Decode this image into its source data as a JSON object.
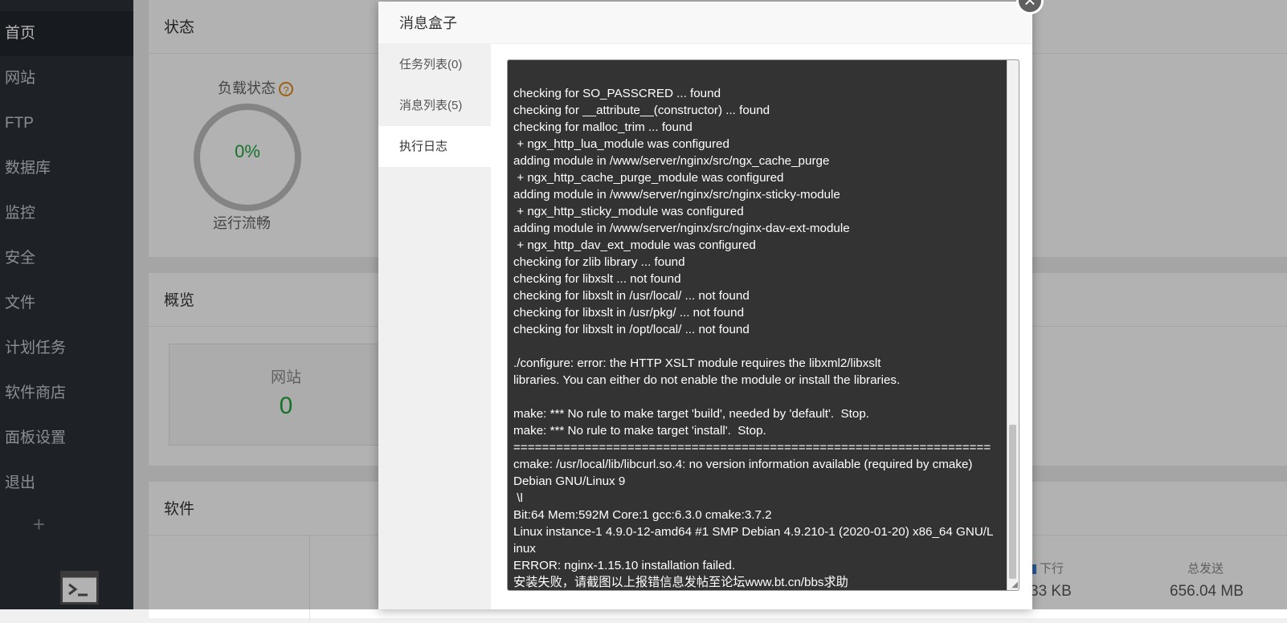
{
  "sidebar": {
    "items": [
      {
        "label": "首页"
      },
      {
        "label": "网站"
      },
      {
        "label": "FTP"
      },
      {
        "label": "数据库"
      },
      {
        "label": "监控"
      },
      {
        "label": "安全"
      },
      {
        "label": "文件"
      },
      {
        "label": "计划任务"
      },
      {
        "label": "软件商店"
      },
      {
        "label": "面板设置"
      },
      {
        "label": "退出"
      }
    ],
    "add_label": "+"
  },
  "status": {
    "title": "状态",
    "load_label": "负载状态",
    "help_glyph": "?",
    "load_value": "0%",
    "load_sub": "运行流畅"
  },
  "overview": {
    "title": "概览",
    "site_label": "网站",
    "site_value": "0"
  },
  "software": {
    "title": "软件"
  },
  "network": {
    "down_label": "下行",
    "down_value": "33 KB",
    "total_sent_label": "总发送",
    "total_sent_value": "656.04 MB"
  },
  "dialog": {
    "title": "消息盒子",
    "close_glyph": "×",
    "tabs": [
      {
        "label": "任务列表(0)"
      },
      {
        "label": "消息列表(5)"
      },
      {
        "label": "执行日志"
      }
    ],
    "log": "checking for SO_PASSCRED ... found\nchecking for __attribute__(constructor) ... found\nchecking for malloc_trim ... found\n + ngx_http_lua_module was configured\nadding module in /www/server/nginx/src/ngx_cache_purge\n + ngx_http_cache_purge_module was configured\nadding module in /www/server/nginx/src/nginx-sticky-module\n + ngx_http_sticky_module was configured\nadding module in /www/server/nginx/src/nginx-dav-ext-module\n + ngx_http_dav_ext_module was configured\nchecking for zlib library ... found\nchecking for libxslt ... not found\nchecking for libxslt in /usr/local/ ... not found\nchecking for libxslt in /usr/pkg/ ... not found\nchecking for libxslt in /opt/local/ ... not found\n\n./configure: error: the HTTP XSLT module requires the libxml2/libxslt\nlibraries. You can either do not enable the module or install the libraries.\n\nmake: *** No rule to make target 'build', needed by 'default'.  Stop.\nmake: *** No rule to make target 'install'.  Stop.\n===================================================================\ncmake: /usr/local/lib/libcurl.so.4: no version information available (required by cmake)\nDebian GNU/Linux 9\n \\l\nBit:64 Mem:592M Core:1 gcc:6.3.0 cmake:3.7.2\nLinux instance-1 4.9.0-12-amd64 #1 SMP Debian 4.9.210-1 (2020-01-20) x86_64 GNU/Linux\nERROR: nginx-1.15.10 installation failed.\n安装失败，请截图以上报错信息发帖至论坛www.bt.cn/bbs求助"
  }
}
